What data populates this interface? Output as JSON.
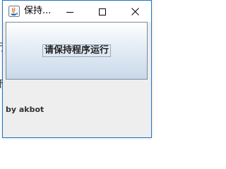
{
  "background": {
    "glyph_top": "行",
    "glyph_bottom": "下"
  },
  "window": {
    "title": "保持...",
    "icon": "java-app-icon",
    "controls": {
      "minimize": "minimize-icon",
      "maximize": "maximize-icon",
      "close": "close-icon"
    }
  },
  "main": {
    "button_label": "请保持程序运行",
    "credit": "by akbot"
  },
  "colors": {
    "window_border": "#1e73c7",
    "content_bg": "#eeeeee",
    "button_gradient_top": "#ffffff",
    "button_gradient_bottom": "#c9d9ea"
  }
}
